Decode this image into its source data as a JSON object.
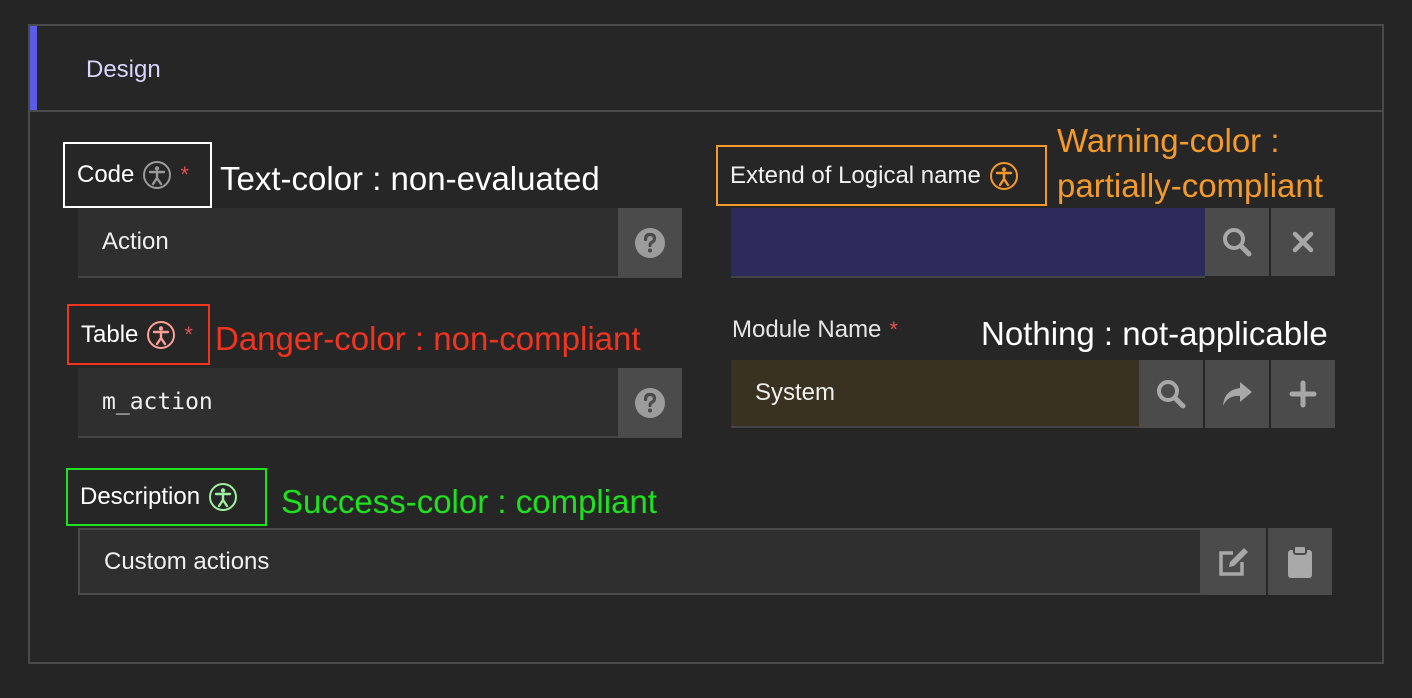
{
  "panel": {
    "title": "Design"
  },
  "fields": {
    "code": {
      "label": "Code",
      "required": "*",
      "value": "Action",
      "annotation": "Text-color : non-evaluated"
    },
    "extend": {
      "label": "Extend of Logical name",
      "value": "",
      "annotation_line1": "Warning-color :",
      "annotation_line2": "partially-compliant"
    },
    "table": {
      "label": "Table",
      "required": "*",
      "value": "m_action",
      "annotation": "Danger-color : non-compliant"
    },
    "module": {
      "label": "Module Name",
      "required": "*",
      "value": "System",
      "annotation": "Nothing : not-applicable"
    },
    "description": {
      "label": "Description",
      "value": "Custom actions",
      "annotation": "Success-color : compliant"
    }
  },
  "colors": {
    "neutral": "#ffffff",
    "warning": "#f39a2a",
    "danger": "#f0341f",
    "success": "#1ee21e",
    "accent": "#5b5be8",
    "extend_input_bg": "#2c2b5c",
    "module_input_bg": "#3a3220"
  },
  "icons": [
    "accessibility-icon",
    "help-icon",
    "search-icon",
    "close-icon",
    "share-icon",
    "plus-icon",
    "edit-icon",
    "clipboard-icon"
  ]
}
